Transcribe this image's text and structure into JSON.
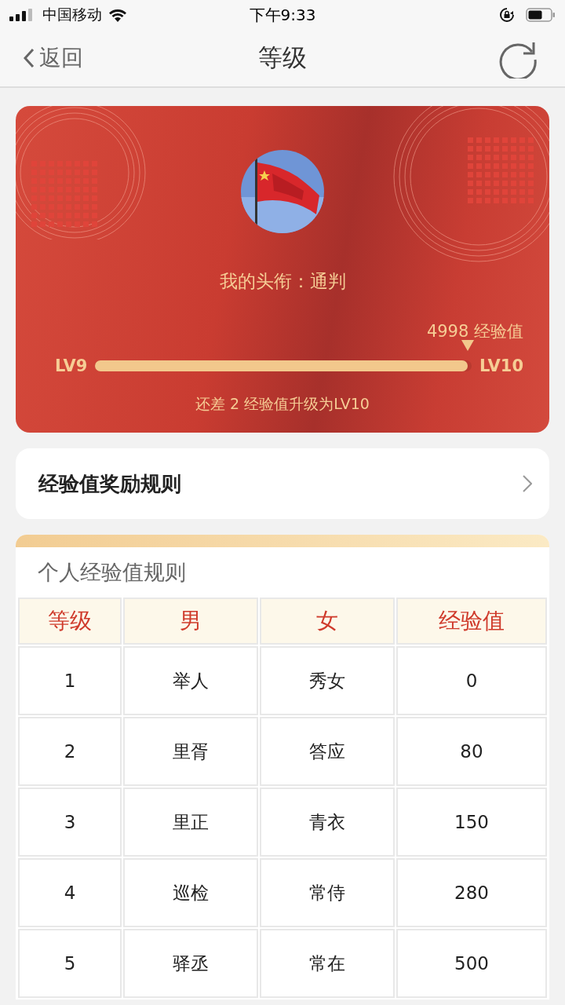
{
  "status_bar": {
    "carrier": "中国移动",
    "time": "下午9:33"
  },
  "nav": {
    "back": "返回",
    "title": "等级"
  },
  "level_card": {
    "title_line": "我的头衔：通判",
    "points": "4998 经验值",
    "from_level": "LV9",
    "to_level": "LV10",
    "progress": {
      "level": 0.99
    },
    "remaining": "还差 2 经验值升级为LV10"
  },
  "rules_link": {
    "label": "经验值奖励规则"
  },
  "rules_table": {
    "title": "个人经验值规则",
    "columns": [
      "等级",
      "男",
      "女",
      "经验值"
    ],
    "rows": [
      [
        "1",
        "举人",
        "秀女",
        "0"
      ],
      [
        "2",
        "里胥",
        "答应",
        "80"
      ],
      [
        "3",
        "里正",
        "青衣",
        "150"
      ],
      [
        "4",
        "巡检",
        "常侍",
        "280"
      ],
      [
        "5",
        "驿丞",
        "常在",
        "500"
      ]
    ]
  }
}
